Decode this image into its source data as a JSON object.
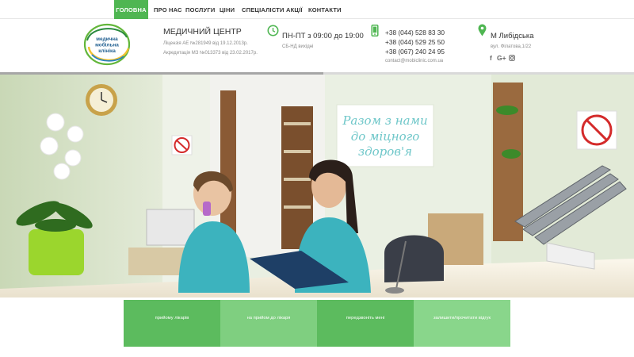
{
  "nav": {
    "items": [
      "ГОЛОВНА",
      "ПРО НАС",
      "ПОСЛУГИ",
      "ЦІНИ",
      "СПЕЦІАЛІСТИ",
      "АКЦІЇ",
      "КОНТАКТИ"
    ],
    "active_plus": "+"
  },
  "logo": {
    "line1": "медична",
    "line2": "мобільна",
    "line3": "клініка"
  },
  "company": {
    "title": "МЕДИЧНИЙ ЦЕНТР",
    "license": "Ліцензія АЕ №281949 від 19.12.2013р.",
    "accreditation": "Акредитація МЗ №013373 від 23.02.2017р."
  },
  "schedule": {
    "weekdays": "ПН-ПТ з 09:00 до 19:00",
    "weekend": "СБ-НД вихідні"
  },
  "contacts": {
    "phone1": "+38 (044) 528 83 30",
    "phone2": "+38 (044) 529 25 50",
    "phone3": "+38 (067) 240 24 95",
    "email": "contact@mobiclinic.com.ua"
  },
  "location": {
    "city": "М Либідська",
    "street": "вул. Філатова,1/22"
  },
  "social": [
    "f",
    "G+",
    "instagram-icon"
  ],
  "hero": {
    "sign_line1": "Разом з нами",
    "sign_line2": "до міцного",
    "sign_line3": "здоров'я"
  },
  "actions": [
    {
      "label": "прийому лікарів",
      "color": "#5cbb5e"
    },
    {
      "label": "на прийом до лікаря",
      "color": "#7fcf80"
    },
    {
      "label": "передзвоніть мені",
      "color": "#5cbb5e"
    },
    {
      "label": "залишити/прочитати відгук",
      "color": "#89d68b"
    }
  ],
  "colors": {
    "brand_green": "#4fb652",
    "text_dark": "#333333",
    "text_muted": "#8a8a8a"
  }
}
